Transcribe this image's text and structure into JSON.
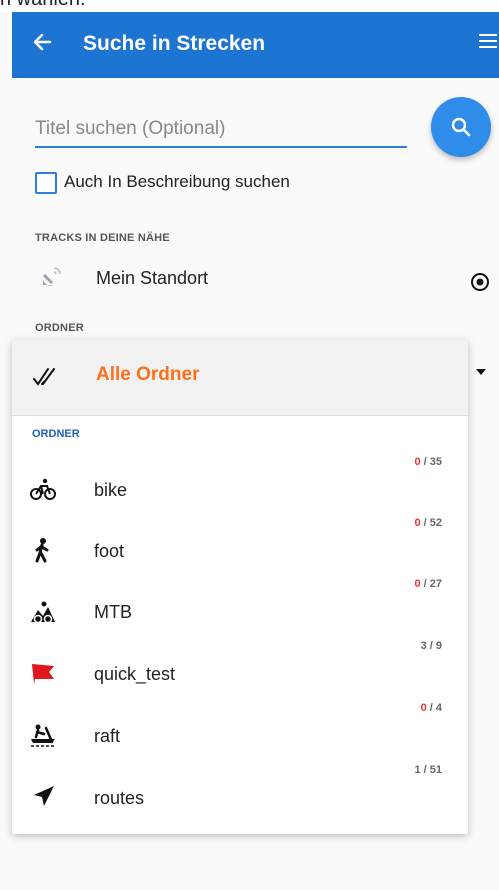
{
  "top_cut_text": "n wählen.",
  "appbar": {
    "title": "Suche in Strecken",
    "back_icon": "arrow-left-icon",
    "menu_icon": "menu-icon",
    "color": "#1e74d2"
  },
  "search": {
    "placeholder": "Titel suchen (Optional)",
    "value": ""
  },
  "checkbox": {
    "label": "Auch In Beschreibung suchen",
    "checked": false
  },
  "nearby": {
    "section_label": "TRACKS IN DEINE NÄHE",
    "item_label": "Mein Standort"
  },
  "folder_section_label": "ORDNER",
  "popup": {
    "selected_label": "Alle Ordner",
    "selected_color": "#ff6f1a",
    "section_label": "ORDNER",
    "items": [
      {
        "name": "bike",
        "count_a": "0",
        "count_b": "/ 35",
        "icon": "bicycle-icon"
      },
      {
        "name": "foot",
        "count_a": "0",
        "count_b": "/ 52",
        "icon": "hiker-icon"
      },
      {
        "name": "MTB",
        "count_a": "0",
        "count_b": "/ 27",
        "icon": "mountain-bike-icon"
      },
      {
        "name": "quick_test",
        "count_a": "3",
        "count_b": "/ 9",
        "icon": "red-flag-icon"
      },
      {
        "name": "raft",
        "count_a": "0",
        "count_b": "/ 4",
        "icon": "raft-icon"
      },
      {
        "name": "routes",
        "count_a": "1",
        "count_b": "/ 51",
        "icon": "navigation-arrow-icon"
      }
    ]
  }
}
